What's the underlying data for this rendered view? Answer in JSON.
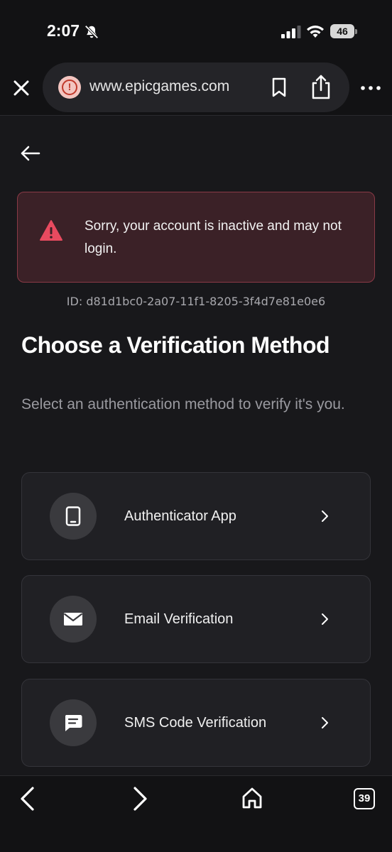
{
  "status_bar": {
    "time": "2:07",
    "battery": "46"
  },
  "browser": {
    "url": "www.epicgames.com",
    "tab_count": "39"
  },
  "alert": {
    "message": "Sorry, your account is inactive and may not login."
  },
  "error_id": "ID: d81d1bc0-2a07-11f1-8205-3f4d7e81e0e6",
  "heading": "Choose a Verification Method",
  "subtitle": "Select an authentication method to verify it's you.",
  "methods": [
    {
      "label": "Authenticator App",
      "icon": "tablet-icon"
    },
    {
      "label": "Email Verification",
      "icon": "envelope-icon"
    },
    {
      "label": "SMS Code Verification",
      "icon": "chat-bubble-icon"
    }
  ],
  "colors": {
    "alert_bg": "#3b2127",
    "alert_border": "#8a3a46",
    "alert_icon": "#e84a5f",
    "page_bg": "#18181b"
  }
}
